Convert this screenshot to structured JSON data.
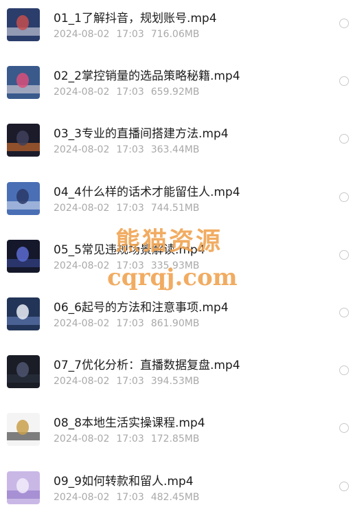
{
  "files": [
    {
      "name": "01_1了解抖音，规划账号.mp4",
      "date": "2024-08-02",
      "time": "17:03",
      "size": "716.06MB",
      "thumb_colors": [
        "#2b3d6b",
        "#e8e8f0",
        "#c44d4d"
      ]
    },
    {
      "name": "02_2掌控销量的选品策略秘籍.mp4",
      "date": "2024-08-02",
      "time": "17:03",
      "size": "659.92MB",
      "thumb_colors": [
        "#3a5a8c",
        "#f0e6e6",
        "#d94f7a"
      ]
    },
    {
      "name": "03_3专业的直播间搭建方法.mp4",
      "date": "2024-08-02",
      "time": "17:03",
      "size": "363.44MB",
      "thumb_colors": [
        "#1b1b2a",
        "#f07b2e",
        "#3f3f5c"
      ]
    },
    {
      "name": "04_4什么样的话术才能留住人.mp4",
      "date": "2024-08-02",
      "time": "17:03",
      "size": "744.51MB",
      "thumb_colors": [
        "#4a6fb5",
        "#dfe7f5",
        "#2a3a66"
      ]
    },
    {
      "name": "05_5常见违规场景解读.mp4",
      "date": "2024-08-02",
      "time": "17:03",
      "size": "335.93MB",
      "thumb_colors": [
        "#15182a",
        "#3d4fa0",
        "#5b6bd0"
      ]
    },
    {
      "name": "06_6起号的方法和注意事项.mp4",
      "date": "2024-08-02",
      "time": "17:03",
      "size": "861.90MB",
      "thumb_colors": [
        "#223457",
        "#6b88c4",
        "#e9edf5"
      ]
    },
    {
      "name": "07_7优化分析：直播数据复盘.mp4",
      "date": "2024-08-02",
      "time": "17:03",
      "size": "394.53MB",
      "thumb_colors": [
        "#1a1d26",
        "#2f3545",
        "#4d5570"
      ]
    },
    {
      "name": "08_8本地生活实操课程.mp4",
      "date": "2024-08-02",
      "time": "17:03",
      "size": "172.85MB",
      "thumb_colors": [
        "#f4f4f4",
        "#1c1c1c",
        "#c9a04a"
      ]
    },
    {
      "name": "09_9如何转款和留人.mp4",
      "date": "2024-08-02",
      "time": "17:03",
      "size": "482.45MB",
      "thumb_colors": [
        "#c9b8e6",
        "#8a6fc4",
        "#f2ecfa"
      ]
    }
  ],
  "watermark": {
    "line1": "熊猫资源",
    "line2": "cqrqj.com"
  }
}
